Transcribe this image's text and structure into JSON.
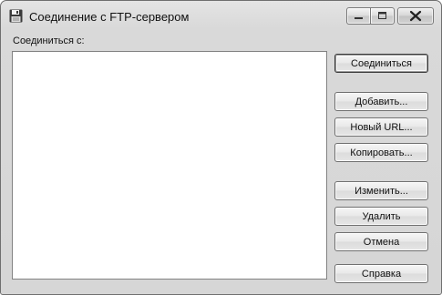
{
  "window": {
    "title": "Соединение с FTP-сервером",
    "icon": "floppy-disk-icon"
  },
  "caption_buttons": {
    "minimize": "minimize-icon",
    "maximize": "maximize-icon",
    "close": "close-icon"
  },
  "connect_label": "Соединиться с:",
  "sites_list": [],
  "buttons": {
    "connect": "Соединиться",
    "add": "Добавить...",
    "new_url": "Новый URL...",
    "copy": "Копировать...",
    "edit": "Изменить...",
    "delete": "Удалить",
    "cancel": "Отмена",
    "help": "Справка"
  }
}
